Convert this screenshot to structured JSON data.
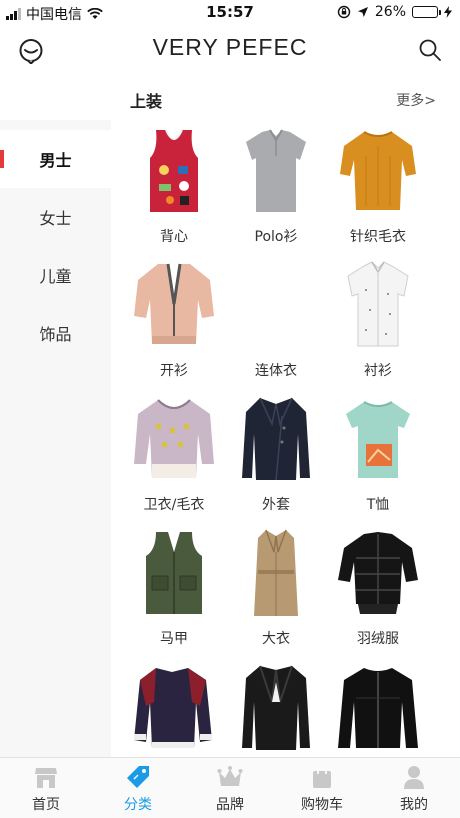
{
  "status_bar": {
    "carrier": "中国电信",
    "time": "15:57",
    "battery_percent": "26%",
    "battery_level": 0.26
  },
  "header": {
    "logo": "VERY PEFEC"
  },
  "sidebar": {
    "items": [
      {
        "label": "男士",
        "active": true
      },
      {
        "label": "女士",
        "active": false
      },
      {
        "label": "儿童",
        "active": false
      },
      {
        "label": "饰品",
        "active": false
      }
    ]
  },
  "section": {
    "title": "上装",
    "more": "更多>"
  },
  "products": [
    {
      "label": "背心",
      "icon": "tank-top-image",
      "color": "#c8233a"
    },
    {
      "label": "Polo衫",
      "icon": "polo-shirt-image",
      "color": "#a9abae"
    },
    {
      "label": "针织毛衣",
      "icon": "knit-sweater-image",
      "color": "#d98f1f"
    },
    {
      "label": "开衫",
      "icon": "cardigan-image",
      "color": "#e8b8a2"
    },
    {
      "label": "连体衣",
      "icon": "jumpsuit-image",
      "color": "#ffffff"
    },
    {
      "label": "衬衫",
      "icon": "dress-shirt-image",
      "color": "#f2f2f2"
    },
    {
      "label": "卫衣/毛衣",
      "icon": "patterned-sweater-image",
      "color": "#c9b7c8"
    },
    {
      "label": "外套",
      "icon": "navy-jacket-image",
      "color": "#1f2535"
    },
    {
      "label": "T恤",
      "icon": "tshirt-image",
      "color": "#9fd6c7"
    },
    {
      "label": "马甲",
      "icon": "vest-image",
      "color": "#4a5a3c"
    },
    {
      "label": "大衣",
      "icon": "trench-coat-image",
      "color": "#b89a72"
    },
    {
      "label": "羽绒服",
      "icon": "puffer-jacket-image",
      "color": "#151515"
    },
    {
      "label": "",
      "icon": "bomber-jacket-image",
      "color": "#2b2440"
    },
    {
      "label": "",
      "icon": "velvet-blazer-image",
      "color": "#1a1a1a"
    },
    {
      "label": "",
      "icon": "leather-jacket-image",
      "color": "#111111"
    }
  ],
  "tabbar": {
    "tabs": [
      {
        "label": "首页",
        "icon": "store-icon",
        "active": false
      },
      {
        "label": "分类",
        "icon": "tag-icon",
        "active": true
      },
      {
        "label": "品牌",
        "icon": "crown-icon",
        "active": false
      },
      {
        "label": "购物车",
        "icon": "shopping-bag-icon",
        "active": false
      },
      {
        "label": "我的",
        "icon": "user-icon",
        "active": false
      }
    ]
  },
  "colors": {
    "accent": "#1a9be8",
    "sidebar_indicator": "#e53a3a",
    "battery_fill": "#4cd964"
  }
}
